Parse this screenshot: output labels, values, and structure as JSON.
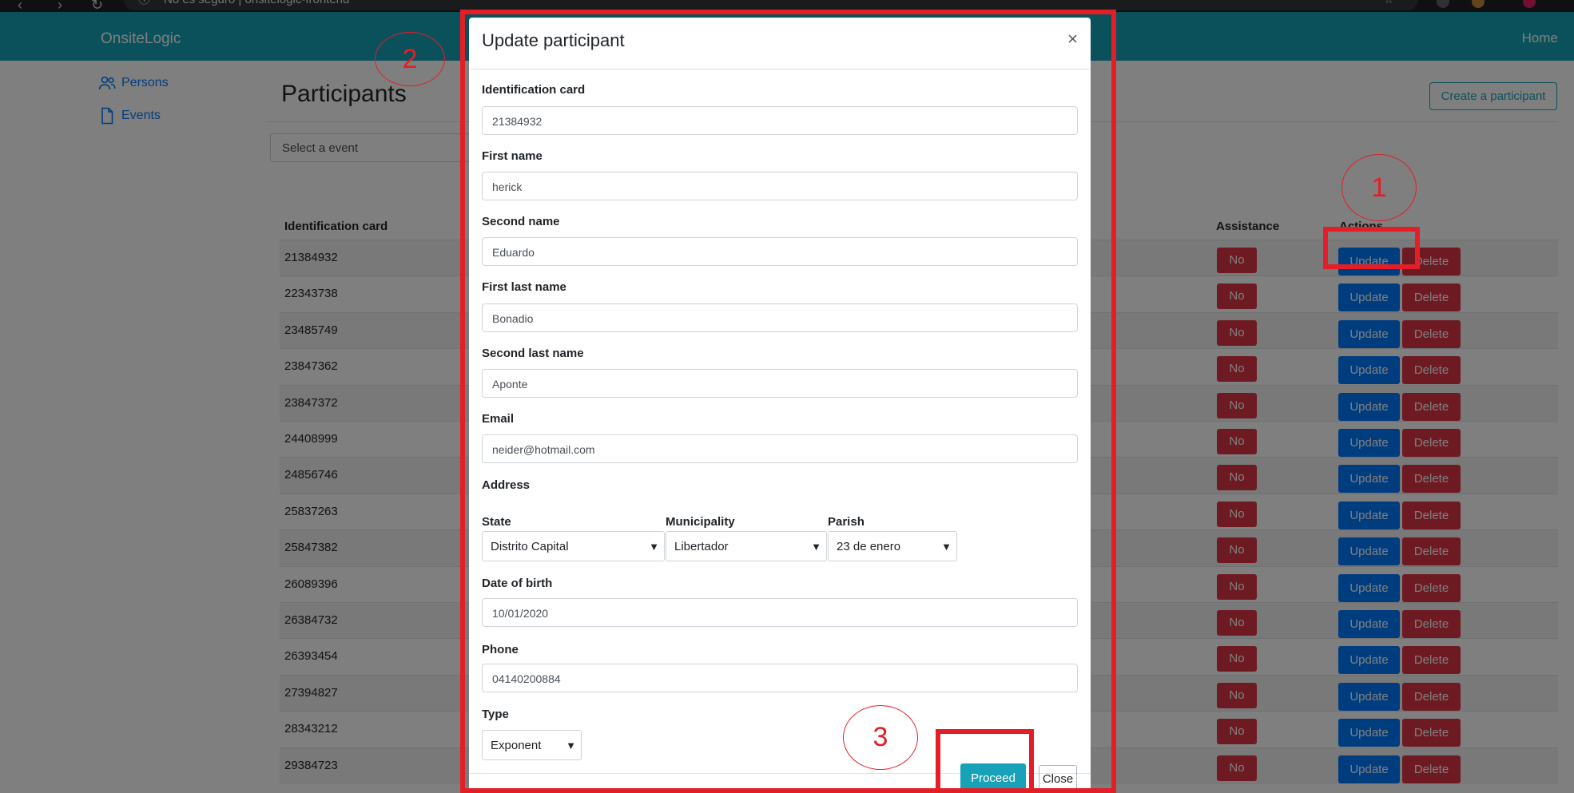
{
  "browser": {
    "url_text": "No es seguro | onsitelogic-frontend"
  },
  "app": {
    "brand": "OnsiteLogic",
    "home": "Home",
    "sidebar": [
      {
        "label": "Persons",
        "icon": "users-icon"
      },
      {
        "label": "Events",
        "icon": "file-icon"
      }
    ],
    "page_title": "Participants",
    "create_button": "Create a participant",
    "event_placeholder": "Select a event",
    "table": {
      "headers": [
        "Identification card",
        "Assistance",
        "Actions"
      ],
      "rows": [
        {
          "id": "21384932",
          "assistance": "No",
          "update": "Update",
          "delete": "Delete"
        },
        {
          "id": "22343738",
          "assistance": "No",
          "update": "Update",
          "delete": "Delete"
        },
        {
          "id": "23485749",
          "assistance": "No",
          "update": "Update",
          "delete": "Delete"
        },
        {
          "id": "23847362",
          "assistance": "No",
          "update": "Update",
          "delete": "Delete"
        },
        {
          "id": "23847372",
          "assistance": "No",
          "update": "Update",
          "delete": "Delete"
        },
        {
          "id": "24408999",
          "assistance": "No",
          "update": "Update",
          "delete": "Delete"
        },
        {
          "id": "24856746",
          "assistance": "No",
          "update": "Update",
          "delete": "Delete"
        },
        {
          "id": "25837263",
          "assistance": "No",
          "update": "Update",
          "delete": "Delete"
        },
        {
          "id": "25847382",
          "assistance": "No",
          "update": "Update",
          "delete": "Delete"
        },
        {
          "id": "26089396",
          "assistance": "No",
          "update": "Update",
          "delete": "Delete"
        },
        {
          "id": "26384732",
          "assistance": "No",
          "update": "Update",
          "delete": "Delete"
        },
        {
          "id": "26393454",
          "assistance": "No",
          "update": "Update",
          "delete": "Delete"
        },
        {
          "id": "27394827",
          "assistance": "No",
          "update": "Update",
          "delete": "Delete"
        },
        {
          "id": "28343212",
          "assistance": "No",
          "update": "Update",
          "delete": "Delete"
        },
        {
          "id": "29384723",
          "assistance": "No",
          "update": "Update",
          "delete": "Delete"
        }
      ]
    }
  },
  "modal": {
    "title": "Update participant",
    "close_glyph": "×",
    "fields": {
      "id_card": {
        "label": "Identification card",
        "value": "21384932"
      },
      "first_name": {
        "label": "First name",
        "value": "herick"
      },
      "second_name": {
        "label": "Second name",
        "value": "Eduardo"
      },
      "first_last_name": {
        "label": "First last name",
        "value": "Bonadio"
      },
      "second_last_name": {
        "label": "Second last name",
        "value": "Aponte"
      },
      "email": {
        "label": "Email",
        "value": "neider@hotmail.com"
      },
      "address_label": "Address",
      "state": {
        "label": "State",
        "value": "Distrito Capital"
      },
      "municipality": {
        "label": "Municipality",
        "value": "Libertador"
      },
      "parish": {
        "label": "Parish",
        "value": "23 de enero"
      },
      "dob": {
        "label": "Date of birth",
        "value": "10/01/2020"
      },
      "phone": {
        "label": "Phone",
        "value": "04140200884"
      },
      "type": {
        "label": "Type",
        "value": "Exponent"
      }
    },
    "proceed": "Proceed",
    "close": "Close"
  },
  "annotations": {
    "step1": "1",
    "step2": "2",
    "step3": "3",
    "color": "#e41e26"
  },
  "colors": {
    "navbar": "#17a2b8",
    "primary": "#007bff",
    "danger": "#dc3545"
  }
}
